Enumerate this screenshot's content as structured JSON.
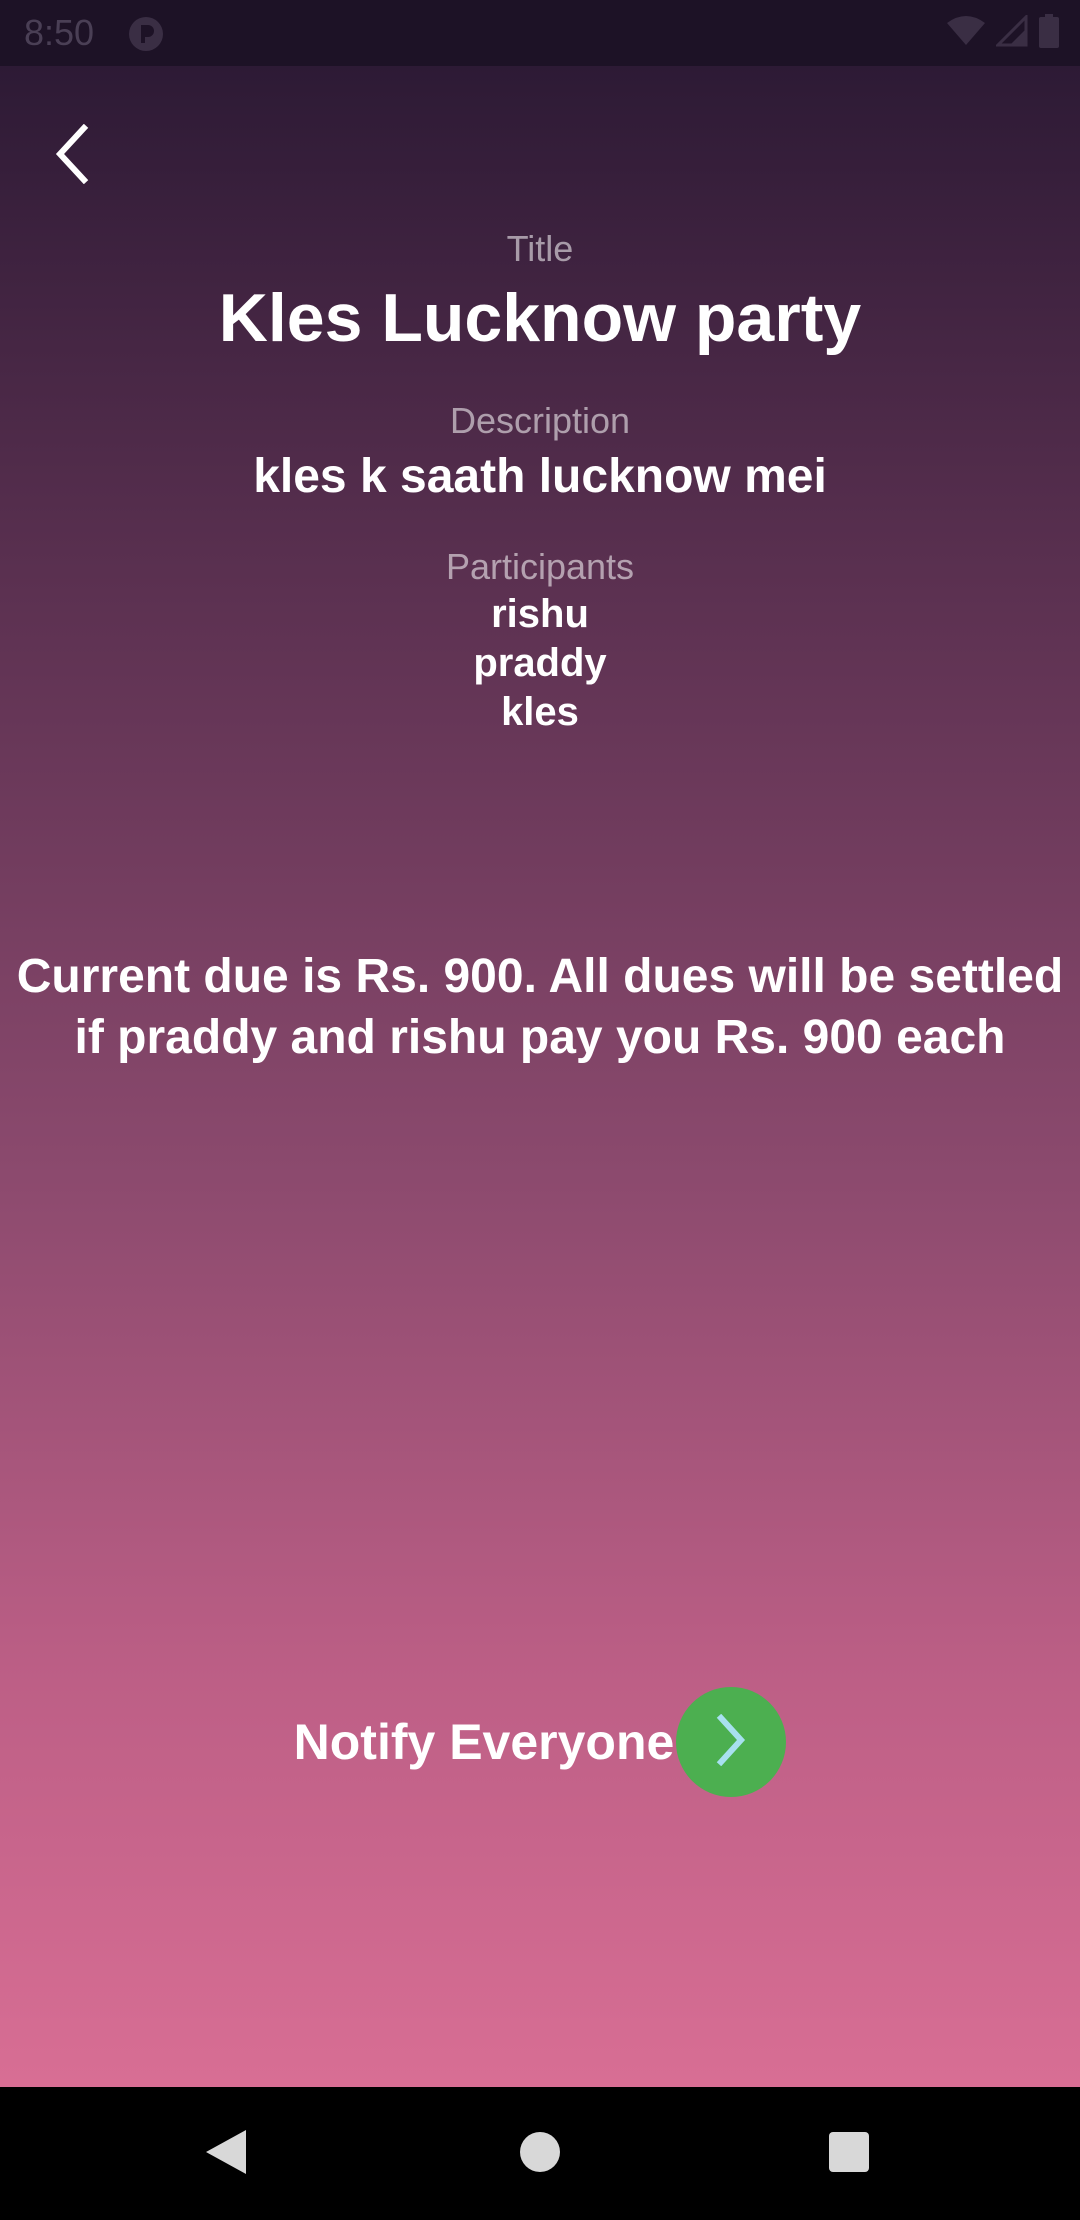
{
  "status_bar": {
    "time": "8:50",
    "icons": [
      "app-notification-icon",
      "wifi-icon",
      "signal-icon",
      "battery-icon"
    ]
  },
  "navigation": {
    "back_icon": "chevron-left-icon"
  },
  "details": {
    "title_label": "Title",
    "title_value": "Kles Lucknow party",
    "description_label": "Description",
    "description_value": "kles k saath lucknow mei",
    "participants_label": "Participants",
    "participants": [
      "rishu",
      "praddy",
      "kles"
    ]
  },
  "summary": {
    "due_line1": "Current due is Rs. 900. All dues will be settled",
    "due_line2": "if praddy and rishu pay you Rs. 900 each"
  },
  "action": {
    "notify_label": "Notify Everyone",
    "notify_icon": "chevron-right-icon",
    "button_color": "#4caf50",
    "arrow_color": "#a8e0f0"
  },
  "system_nav": {
    "back": "triangle-back-icon",
    "home": "circle-home-icon",
    "recents": "square-recents-icon"
  }
}
